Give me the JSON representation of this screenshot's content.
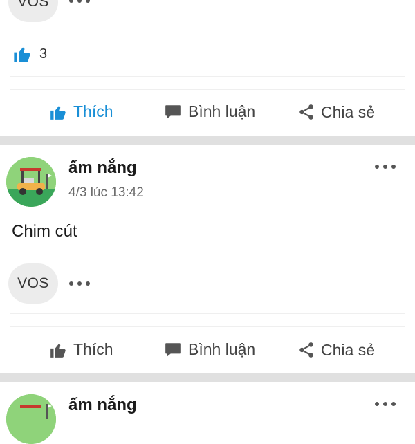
{
  "post_top": {
    "reaction_chip": "VOS",
    "like_count": "3",
    "actions": {
      "like": "Thích",
      "comment": "Bình luận",
      "share": "Chia sẻ"
    }
  },
  "post_main": {
    "username": "ấm nắng",
    "timestamp": "4/3 lúc 13:42",
    "content": "Chim cút",
    "reaction_chip": "VOS",
    "actions": {
      "like": "Thích",
      "comment": "Bình luận",
      "share": "Chia sẻ"
    }
  },
  "post_next": {
    "username": "ấm nắng"
  },
  "icons": {
    "like": "thumbs-up-icon",
    "comment": "speech-bubble-icon",
    "share": "share-icon",
    "more": "more-dots-icon"
  },
  "colors": {
    "accent": "#1a8fd6",
    "separator": "#e0e0e0",
    "chip_bg": "#ececec"
  }
}
